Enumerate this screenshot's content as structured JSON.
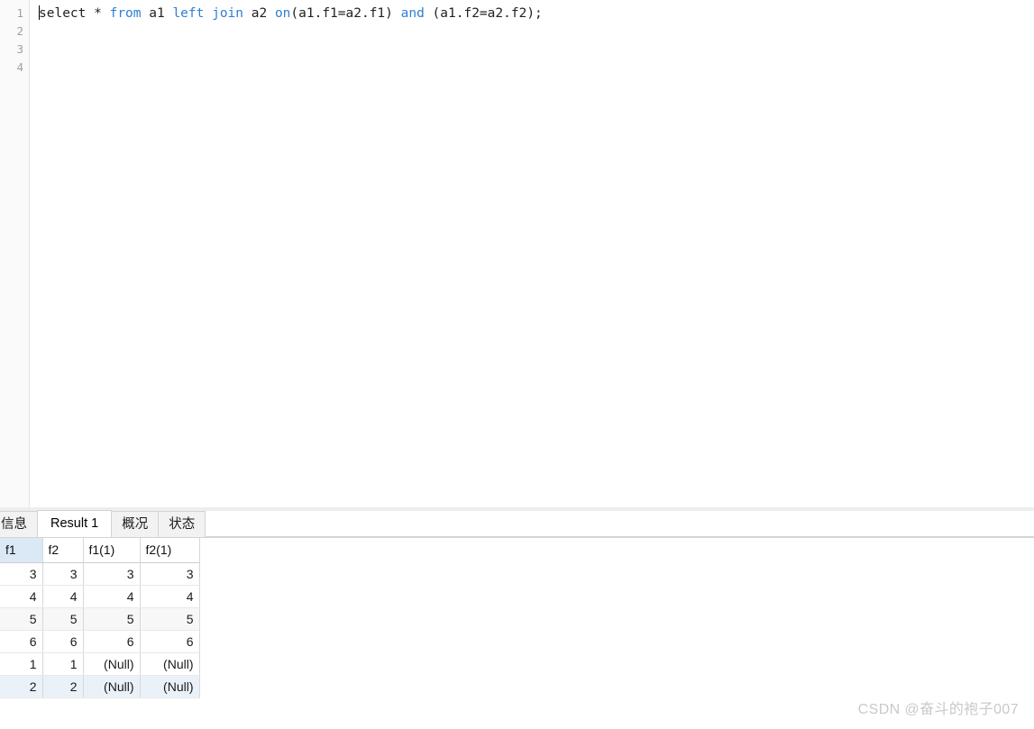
{
  "editor": {
    "line_numbers": [
      "1",
      "2",
      "3",
      "4"
    ],
    "caret_line": 1,
    "lines": [
      {
        "tokens": [
          {
            "text": "select",
            "type": "plain"
          },
          {
            "text": " * ",
            "type": "plain"
          },
          {
            "text": "from",
            "type": "keyword"
          },
          {
            "text": " a1 ",
            "type": "plain"
          },
          {
            "text": "left",
            "type": "keyword"
          },
          {
            "text": " ",
            "type": "plain"
          },
          {
            "text": "join",
            "type": "keyword"
          },
          {
            "text": " a2 ",
            "type": "plain"
          },
          {
            "text": "on",
            "type": "keyword"
          },
          {
            "text": "(a1.f1=a2.f1) ",
            "type": "plain"
          },
          {
            "text": "and",
            "type": "keyword"
          },
          {
            "text": " (a1.f2=a2.f2);",
            "type": "plain"
          }
        ],
        "plain_text": "select * from a1 left join a2 on(a1.f1=a2.f1) and (a1.f2=a2.f2);"
      },
      {
        "tokens": [],
        "plain_text": ""
      },
      {
        "tokens": [],
        "plain_text": ""
      },
      {
        "tokens": [],
        "plain_text": ""
      }
    ]
  },
  "result_panel": {
    "tabs": [
      {
        "label": "信息",
        "active": false
      },
      {
        "label": "Result 1",
        "active": true
      },
      {
        "label": "概况",
        "active": false
      },
      {
        "label": "状态",
        "active": false
      }
    ],
    "grid": {
      "columns": [
        {
          "label": "f1",
          "selected": true
        },
        {
          "label": "f2",
          "selected": false
        },
        {
          "label": "f1(1)",
          "selected": false
        },
        {
          "label": "f2(1)",
          "selected": false
        }
      ],
      "rows": [
        {
          "cells": [
            "3",
            "3",
            "3",
            "3"
          ],
          "nulls": [
            false,
            false,
            false,
            false
          ],
          "alt": false,
          "selected": false
        },
        {
          "cells": [
            "4",
            "4",
            "4",
            "4"
          ],
          "nulls": [
            false,
            false,
            false,
            false
          ],
          "alt": false,
          "selected": false
        },
        {
          "cells": [
            "5",
            "5",
            "5",
            "5"
          ],
          "nulls": [
            false,
            false,
            false,
            false
          ],
          "alt": true,
          "selected": false
        },
        {
          "cells": [
            "6",
            "6",
            "6",
            "6"
          ],
          "nulls": [
            false,
            false,
            false,
            false
          ],
          "alt": false,
          "selected": false
        },
        {
          "cells": [
            "1",
            "1",
            "(Null)",
            "(Null)"
          ],
          "nulls": [
            false,
            false,
            true,
            true
          ],
          "alt": false,
          "selected": false
        },
        {
          "cells": [
            "2",
            "2",
            "(Null)",
            "(Null)"
          ],
          "nulls": [
            false,
            false,
            true,
            true
          ],
          "alt": false,
          "selected": true
        }
      ]
    }
  },
  "watermark": {
    "text": "CSDN @奋斗的袍子007"
  },
  "colors": {
    "keyword": "#2f7fd1",
    "code_text": "#222222",
    "gutter_bg": "#fafafa",
    "line_number": "#a0a0a0",
    "selected_column_header": "#dbe9f7",
    "selected_row": "#eaf1f9",
    "alt_row": "#f7f7f7",
    "null_text": "#b9bcc2",
    "watermark": "#c9c9c9",
    "tab_inactive_bg": "#f2f2f2",
    "tab_active_bg": "#ffffff"
  }
}
